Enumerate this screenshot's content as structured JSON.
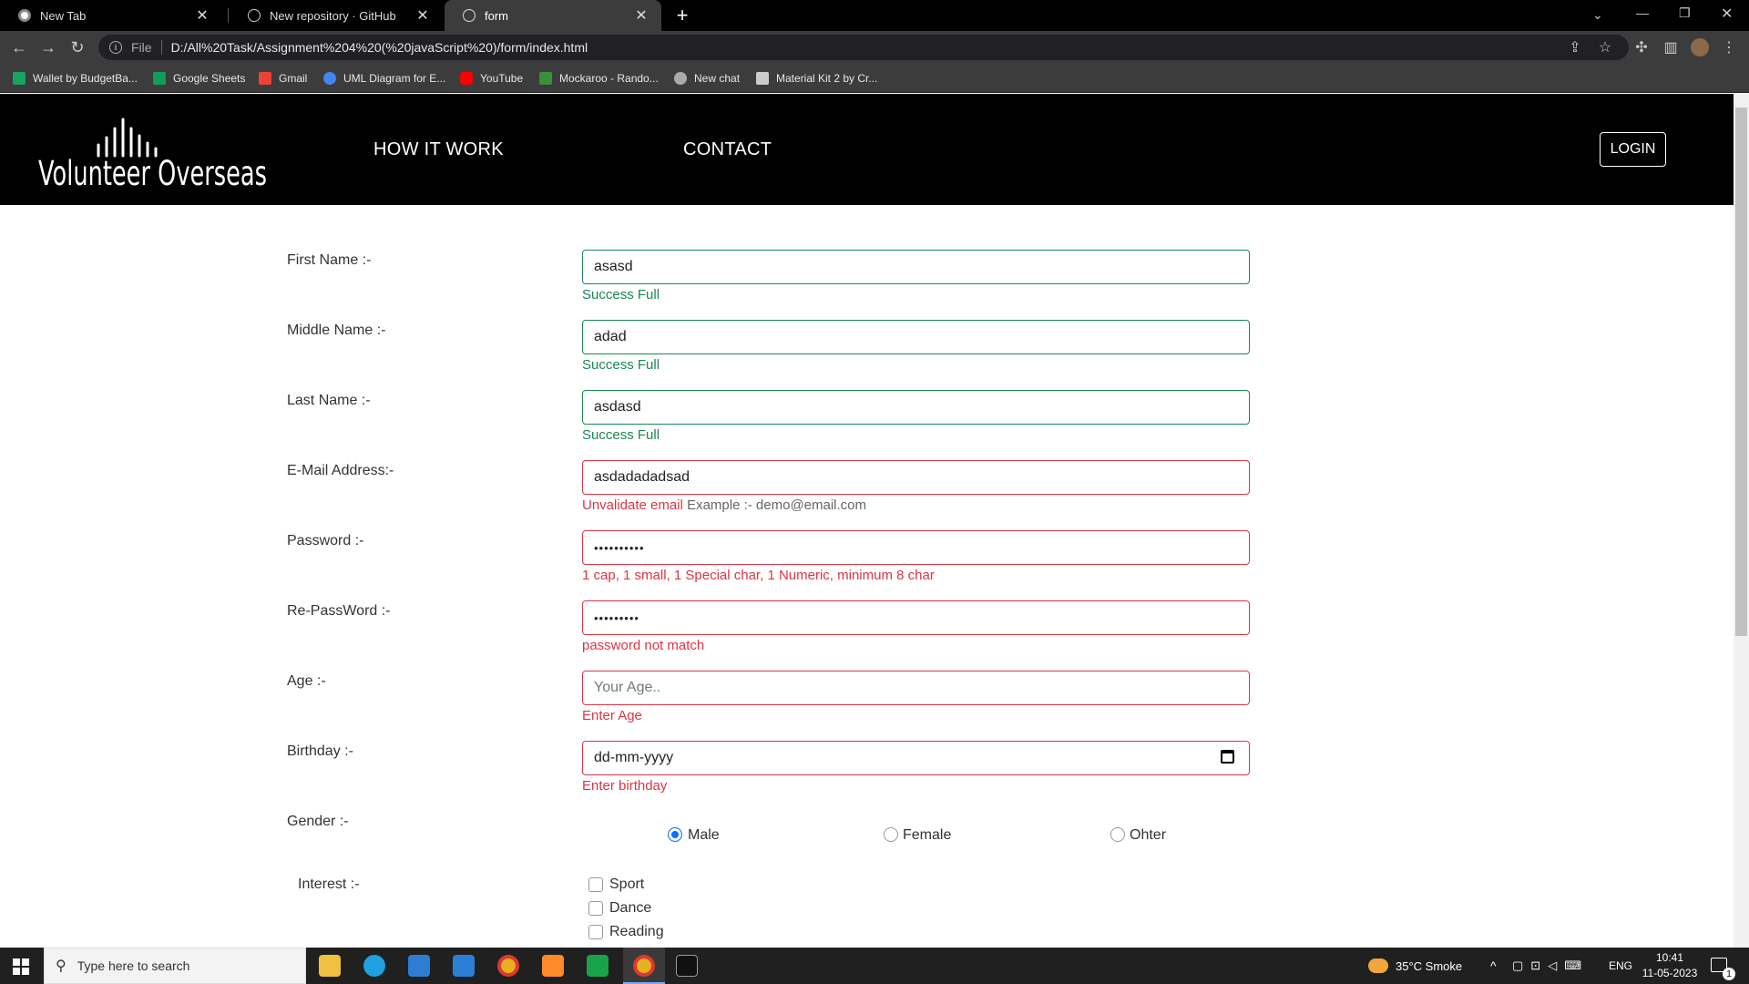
{
  "browser": {
    "tabs": [
      {
        "title": "New Tab",
        "active": false
      },
      {
        "title": "New repository · GitHub",
        "active": false
      },
      {
        "title": "form",
        "active": true
      }
    ],
    "new_tab_symbol": "+",
    "address": {
      "scheme": "File",
      "url": "D:/All%20Task/Assignment%204%20(%20javaScript%20)/form/index.html"
    },
    "bookmarks": [
      {
        "label": "Wallet by BudgetBa...",
        "color": "#1aa260"
      },
      {
        "label": "Google Sheets",
        "color": "#0f9d58"
      },
      {
        "label": "Gmail",
        "color": "#ea4335"
      },
      {
        "label": "UML Diagram for E...",
        "color": "#4285f4"
      },
      {
        "label": "YouTube",
        "color": "#ff0000"
      },
      {
        "label": "Mockaroo - Rando...",
        "color": "#3a8f3a"
      },
      {
        "label": "New chat",
        "color": "#aaaaaa"
      },
      {
        "label": "Material Kit 2 by Cr...",
        "color": "#cccccc"
      }
    ]
  },
  "site": {
    "logo_text": "Volunteer Overseas",
    "nav": [
      "HOW IT WORK",
      "CONTACT"
    ],
    "login_label": "LOGIN"
  },
  "form": {
    "fields": [
      {
        "label": "First Name :-",
        "value": "asasd",
        "state": "ok",
        "message": "Success Full"
      },
      {
        "label": "Middle Name :-",
        "value": "adad",
        "state": "ok",
        "message": "Success Full"
      },
      {
        "label": "Last Name :-",
        "value": "asdasd",
        "state": "ok",
        "message": "Success Full"
      },
      {
        "label": "E-Mail Address:-",
        "value": "asdadadadsad",
        "state": "bad",
        "message": "Unvalidate email",
        "message_hint": "Example :- demo@email.com"
      },
      {
        "label": "Password :-",
        "value": "••••••••••",
        "state": "bad",
        "message": "1 cap, 1 small, 1 Special char, 1 Numeric, minimum 8 char"
      },
      {
        "label": "Re-PassWord :-",
        "value": "•••••••••",
        "state": "bad",
        "message": "password not match"
      },
      {
        "label": "Age :-",
        "placeholder": "Your Age..",
        "state": "bad",
        "message": "Enter Age"
      },
      {
        "label": "Birthday :-",
        "value": "dd-mm-yyyy",
        "state": "bad",
        "message": "Enter birthday"
      }
    ],
    "gender": {
      "label": "Gender :-",
      "options": [
        "Male",
        "Female",
        "Ohter"
      ],
      "selected": "Male"
    },
    "interest": {
      "label": "Interest :-",
      "options": [
        "Sport",
        "Dance",
        "Reading"
      ]
    }
  },
  "taskbar": {
    "search_placeholder": "Type here to search",
    "weather": "35°C  Smoke",
    "lang": "ENG",
    "time": "10:41",
    "date": "11-05-2023",
    "notification_count": "1"
  },
  "colors": {
    "success": "#198754",
    "danger": "#dc3545",
    "accent": "#0d6efd"
  }
}
